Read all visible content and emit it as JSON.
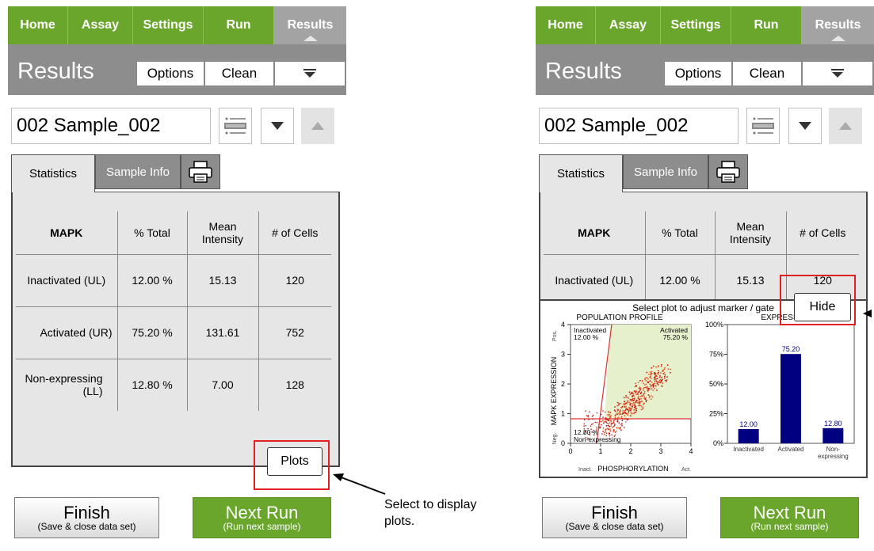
{
  "nav": [
    "Home",
    "Assay",
    "Settings",
    "Run",
    "Results"
  ],
  "results_bar": {
    "title": "Results",
    "options": "Options",
    "clean": "Clean",
    "menu_glyph": "▼"
  },
  "sample": {
    "name": "002 Sample_002"
  },
  "tabs": {
    "statistics": "Statistics",
    "sample_info": "Sample Info"
  },
  "table": {
    "headers": [
      "MAPK",
      "% Total",
      "Mean Intensity",
      "# of Cells"
    ],
    "header_lines": {
      "mean1": "Mean",
      "mean2": "Intensity"
    },
    "rows": [
      {
        "label": "Inactivated (UL)",
        "pct": "12.00 %",
        "mean": "15.13",
        "cells": "120"
      },
      {
        "label": "Activated (UR)",
        "pct": "75.20 %",
        "mean": "131.61",
        "cells": "752"
      },
      {
        "label1": "Non-expressing",
        "label2": "(LL)",
        "pct": "12.80 %",
        "mean": "7.00",
        "cells": "128"
      }
    ]
  },
  "left_overlay_btn": "Plots",
  "right_overlay_btn": "Hide",
  "plot_caption": "Select plot to adjust marker / gate",
  "scatter": {
    "title": "POPULATION PROFILE",
    "ylabel": "MAPK EXPRESSION",
    "ylabel_pos": "Pos.",
    "ylabel_neg": "Neg.",
    "xlabel": "PHOSPHORYLATION",
    "xlabel_inact": "Inact.",
    "xlabel_act": "Act.",
    "x_ticks": [
      "0",
      "1",
      "2",
      "3",
      "4"
    ],
    "y_ticks": [
      "0",
      "1",
      "2",
      "3",
      "4"
    ],
    "q_inact": "Inactivated",
    "q_inact_pct": "12.00 %",
    "q_act": "Activated",
    "q_act_pct": "75.20 %",
    "q_non_pct": "12.80 %",
    "q_non": "Non-expressing"
  },
  "chart_data": {
    "type": "bar",
    "title": "EXPRESSION (%)",
    "categories": [
      "Inactivated",
      "Activated",
      "Non-expressing"
    ],
    "category_lines": [
      [
        "Inactivated"
      ],
      [
        "Activated"
      ],
      [
        "Non-",
        "expressing"
      ]
    ],
    "values": [
      12.0,
      75.2,
      12.8
    ],
    "value_labels": [
      "12.00",
      "75.20",
      "12.80"
    ],
    "y_ticks": [
      "0%",
      "25%",
      "50%",
      "75%",
      "100%"
    ],
    "ylim": [
      0,
      100
    ],
    "bar_color": "#000080"
  },
  "buttons": {
    "finish": "Finish",
    "finish_sub": "(Save & close data set)",
    "next": "Next Run",
    "next_sub": "(Run next sample)"
  },
  "note": {
    "line1": "Select to display",
    "line2": "plots."
  },
  "colors": {
    "nav_green": "#6aa52c",
    "header_gray": "#8d8d8d",
    "callout_red": "#e02020",
    "gate_fill": "#e6f0cd"
  }
}
